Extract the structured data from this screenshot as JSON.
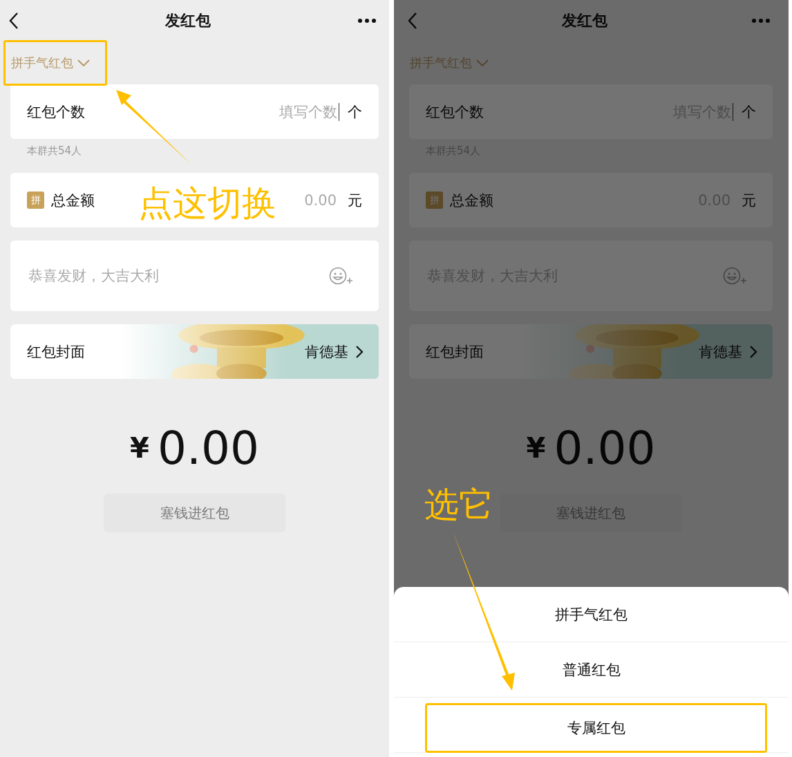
{
  "screens": [
    {
      "dimmed": false,
      "title": "发红包",
      "type_selector": {
        "label": "拼手气红包",
        "highlighted": true
      },
      "count": {
        "label": "红包个数",
        "placeholder": "填写个数",
        "unit": "个"
      },
      "hint": "本群共54人",
      "amount": {
        "badge": "拼",
        "label": "总金额",
        "placeholder": "0.00",
        "unit": "元"
      },
      "greeting": {
        "placeholder": "恭喜发财，大吉大利"
      },
      "cover": {
        "label": "红包封面",
        "value": "肯德基"
      },
      "total": {
        "currency": "¥",
        "value": "0.00"
      },
      "submit": {
        "label": "塞钱进红包",
        "disabled": true
      },
      "annotation": "点这切换"
    },
    {
      "dimmed": true,
      "title": "发红包",
      "type_selector": {
        "label": "拼手气红包",
        "highlighted": false
      },
      "count": {
        "label": "红包个数",
        "placeholder": "填写个数",
        "unit": "个"
      },
      "hint": "本群共54人",
      "amount": {
        "badge": "拼",
        "label": "总金额",
        "placeholder": "0.00",
        "unit": "元"
      },
      "greeting": {
        "placeholder": "恭喜发财，大吉大利"
      },
      "cover": {
        "label": "红包封面",
        "value": "肯德基"
      },
      "total": {
        "currency": "¥",
        "value": "0.00"
      },
      "submit": {
        "label": "塞钱进红包",
        "disabled": true
      },
      "annotation": "选它",
      "action_sheet": [
        {
          "label": "拼手气红包",
          "highlighted": false
        },
        {
          "label": "普通红包",
          "highlighted": false
        },
        {
          "label": "专属红包",
          "highlighted": true
        }
      ]
    }
  ]
}
